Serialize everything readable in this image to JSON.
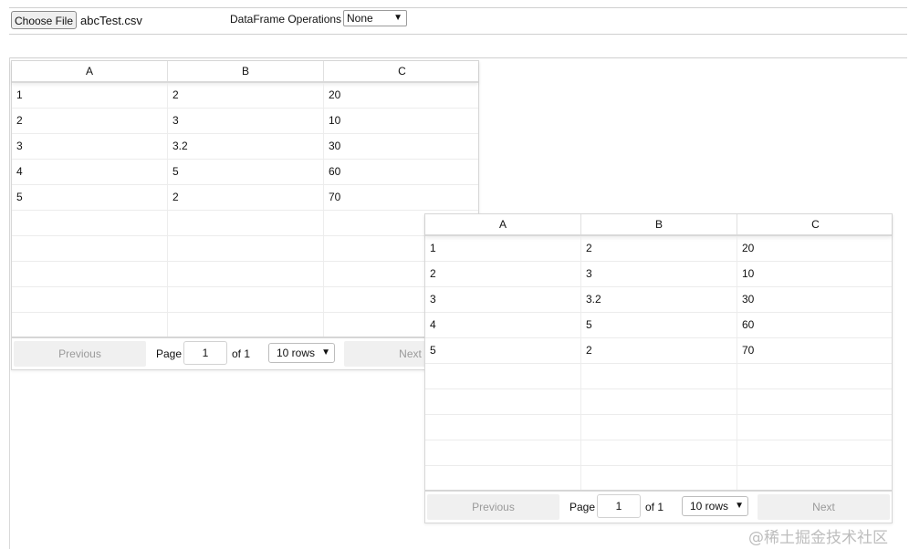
{
  "toolbar": {
    "choose_file_label": "Choose File",
    "file_name": "abcTest.csv",
    "operations_label": "DataFrame Operations",
    "operations_value": "None"
  },
  "tables": [
    {
      "headers": [
        "A",
        "B",
        "C"
      ],
      "rows": [
        [
          "1",
          "2",
          "20"
        ],
        [
          "2",
          "3",
          "10"
        ],
        [
          "3",
          "3.2",
          "30"
        ],
        [
          "4",
          "5",
          "60"
        ],
        [
          "5",
          "2",
          "70"
        ]
      ],
      "empty_rows": 5,
      "pagination": {
        "previous": "Previous",
        "page_label": "Page",
        "page_value": "1",
        "of_label": "of 1",
        "rows_per_page": "10 rows",
        "next": "Next"
      }
    },
    {
      "headers": [
        "A",
        "B",
        "C"
      ],
      "rows": [
        [
          "1",
          "2",
          "20"
        ],
        [
          "2",
          "3",
          "10"
        ],
        [
          "3",
          "3.2",
          "30"
        ],
        [
          "4",
          "5",
          "60"
        ],
        [
          "5",
          "2",
          "70"
        ]
      ],
      "empty_rows": 5,
      "pagination": {
        "previous": "Previous",
        "page_label": "Page",
        "page_value": "1",
        "of_label": "of 1",
        "rows_per_page": "10 rows",
        "next": "Next"
      }
    }
  ],
  "watermark": "@稀土掘金技术社区",
  "icons": {
    "dropdown": "chevron-down-icon"
  }
}
